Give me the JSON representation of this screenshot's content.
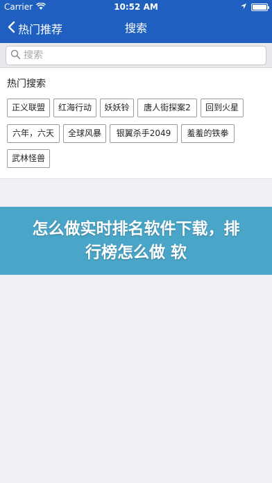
{
  "status_bar": {
    "carrier": "Carrier",
    "time": "10:52 AM"
  },
  "nav": {
    "back_label": "热门推荐",
    "title": "搜索"
  },
  "search": {
    "placeholder": "搜索"
  },
  "hot": {
    "title": "热门搜索",
    "tags": [
      "正义联盟",
      "红海行动",
      "妖妖铃",
      "唐人街探案2",
      "回到火星",
      "六年，六天",
      "全球风暴",
      "银翼杀手2049",
      "羞羞的铁拳",
      "武林怪兽"
    ]
  },
  "banner": {
    "text": "怎么做实时排名软件下载，排行榜怎么做 软"
  },
  "colors": {
    "nav_background": "#1e5fbf",
    "banner_background": "#4aa6c8",
    "page_background": "#efeff4"
  }
}
